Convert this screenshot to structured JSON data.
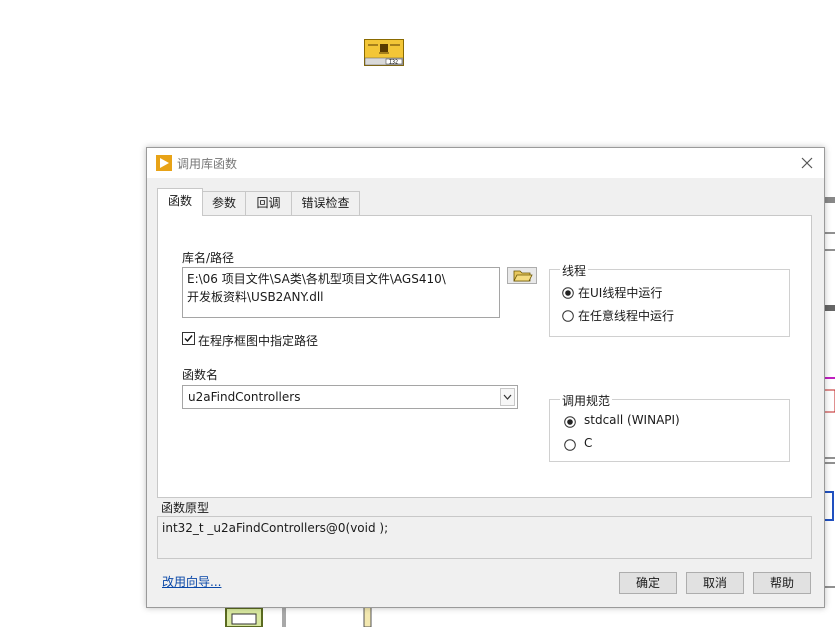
{
  "dialog": {
    "title": "调用库函数",
    "tabs": [
      {
        "label": "函数"
      },
      {
        "label": "参数"
      },
      {
        "label": "回调"
      },
      {
        "label": "错误检查"
      }
    ],
    "library": {
      "label": "库名/路径",
      "path_value": "E:\\06 项目文件\\SA类\\各机型项目文件\\AGS410\\\n开发板资料\\USB2ANY.dll",
      "specify_path_label": "在程序框图中指定路径"
    },
    "function": {
      "label": "函数名",
      "selected": "u2aFindControllers"
    },
    "thread": {
      "title": "线程",
      "options": [
        "在UI线程中运行",
        "在任意线程中运行"
      ],
      "selected_index": 0
    },
    "calling_convention": {
      "title": "调用规范",
      "options": [
        "stdcall (WINAPI)",
        "C"
      ],
      "selected_index": 0
    },
    "prototype": {
      "label": "函数原型",
      "text": "int32_t _u2aFindControllers@0(void );"
    },
    "wizard_link": "改用向导...",
    "buttons": {
      "ok": "确定",
      "cancel": "取消",
      "help": "帮助"
    }
  },
  "colors": {
    "accent": "#e8a317",
    "link": "#0a48a8"
  }
}
